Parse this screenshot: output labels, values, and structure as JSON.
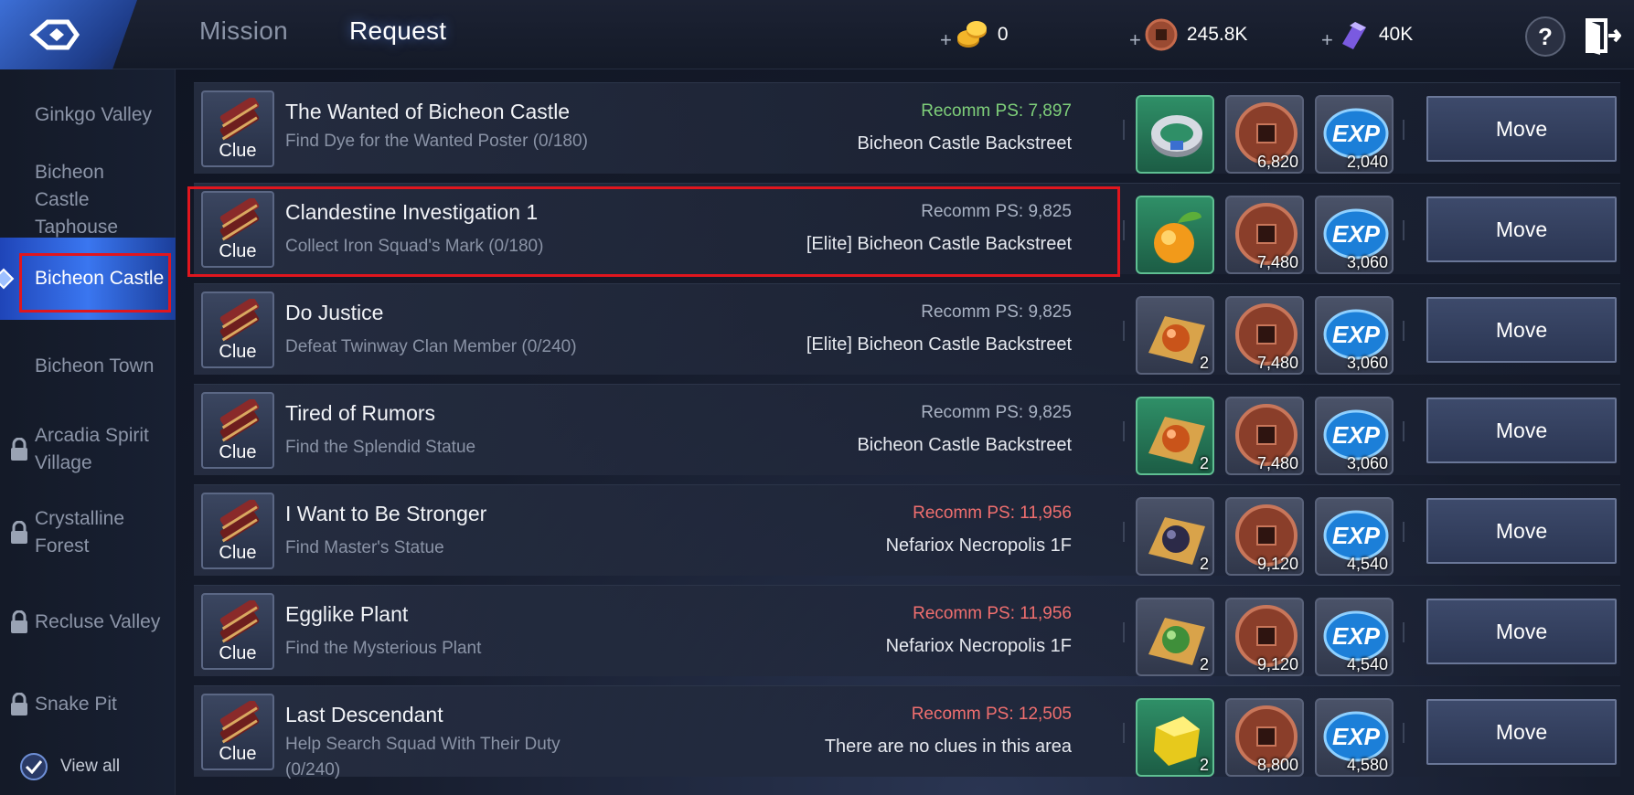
{
  "tabs": {
    "mission": "Mission",
    "request": "Request"
  },
  "currency": [
    {
      "icon": "gold-coins-icon",
      "value": "0"
    },
    {
      "icon": "copper-coin-icon",
      "value": "245.8K"
    },
    {
      "icon": "crystal-icon",
      "value": "40K"
    }
  ],
  "help_label": "?",
  "sidebar": {
    "items": [
      {
        "label": "Ginkgo Valley",
        "locked": false
      },
      {
        "label": "Bicheon Castle Taphouse",
        "locked": false
      },
      {
        "label": "Bicheon Castle",
        "locked": false,
        "active": true
      },
      {
        "label": "Bicheon Town",
        "locked": false
      },
      {
        "label": "Arcadia Spirit Village",
        "locked": true
      },
      {
        "label": "Crystalline Forest",
        "locked": true
      },
      {
        "label": "Recluse Valley",
        "locked": true
      },
      {
        "label": "Snake Pit",
        "locked": true
      }
    ],
    "view_all": "View all"
  },
  "quests": [
    {
      "clue": "Clue",
      "title": "The Wanted of Bicheon Castle",
      "desc": "Find Dye for the Wanted Poster (0/180)",
      "ps": "Recomm PS: 7,897",
      "ps_color": "green",
      "location": "Bicheon Castle Backstreet",
      "reward1": {
        "icon": "bracelet-icon",
        "qty": ""
      },
      "coin_qty": "6,820",
      "exp_qty": "2,040",
      "move": "Move"
    },
    {
      "clue": "Clue",
      "title": "Clandestine Investigation 1",
      "desc": "Collect Iron Squad's Mark (0/180)",
      "ps": "Recomm PS: 9,825",
      "ps_color": "gray",
      "location": "[Elite] Bicheon Castle Backstreet",
      "reward1": {
        "icon": "orange-fruit-icon",
        "qty": ""
      },
      "coin_qty": "7,480",
      "exp_qty": "3,060",
      "move": "Move"
    },
    {
      "clue": "Clue",
      "title": "Do Justice",
      "desc": "Defeat Twinway Clan Member (0/240)",
      "ps": "Recomm PS: 9,825",
      "ps_color": "gray",
      "location": "[Elite] Bicheon Castle Backstreet",
      "reward1": {
        "icon": "orb-orange-icon",
        "qty": "2"
      },
      "coin_qty": "7,480",
      "exp_qty": "3,060",
      "move": "Move"
    },
    {
      "clue": "Clue",
      "title": "Tired of Rumors",
      "desc": "Find the Splendid Statue",
      "ps": "Recomm PS: 9,825",
      "ps_color": "gray",
      "location": "Bicheon Castle Backstreet",
      "reward1": {
        "icon": "orb-orange-icon",
        "qty": "2"
      },
      "coin_qty": "7,480",
      "exp_qty": "3,060",
      "move": "Move"
    },
    {
      "clue": "Clue",
      "title": "I Want to Be Stronger",
      "desc": "Find Master's Statue",
      "ps": "Recomm PS: 11,956",
      "ps_color": "red",
      "location": "Nefariox Necropolis 1F",
      "reward1": {
        "icon": "orb-dark-icon",
        "qty": "2"
      },
      "coin_qty": "9,120",
      "exp_qty": "4,540",
      "move": "Move"
    },
    {
      "clue": "Clue",
      "title": "Egglike Plant",
      "desc": "Find the Mysterious Plant",
      "ps": "Recomm PS: 11,956",
      "ps_color": "red",
      "location": "Nefariox Necropolis 1F",
      "reward1": {
        "icon": "orb-green-icon",
        "qty": "2"
      },
      "coin_qty": "9,120",
      "exp_qty": "4,540",
      "move": "Move"
    },
    {
      "clue": "Clue",
      "title": "Last Descendant",
      "desc": "Help Search Squad With Their Duty (0/240)",
      "ps": "Recomm PS: 12,505",
      "ps_color": "red",
      "location": "There are no clues in this area",
      "reward1": {
        "icon": "gold-chunk-icon",
        "qty": "2"
      },
      "coin_qty": "8,800",
      "exp_qty": "4,580",
      "move": "Move"
    }
  ],
  "colors": {
    "highlight": "#e0161e",
    "ps_green": "#7fd07a",
    "ps_red": "#f06f6f",
    "accent_blue": "#3a76f0"
  }
}
